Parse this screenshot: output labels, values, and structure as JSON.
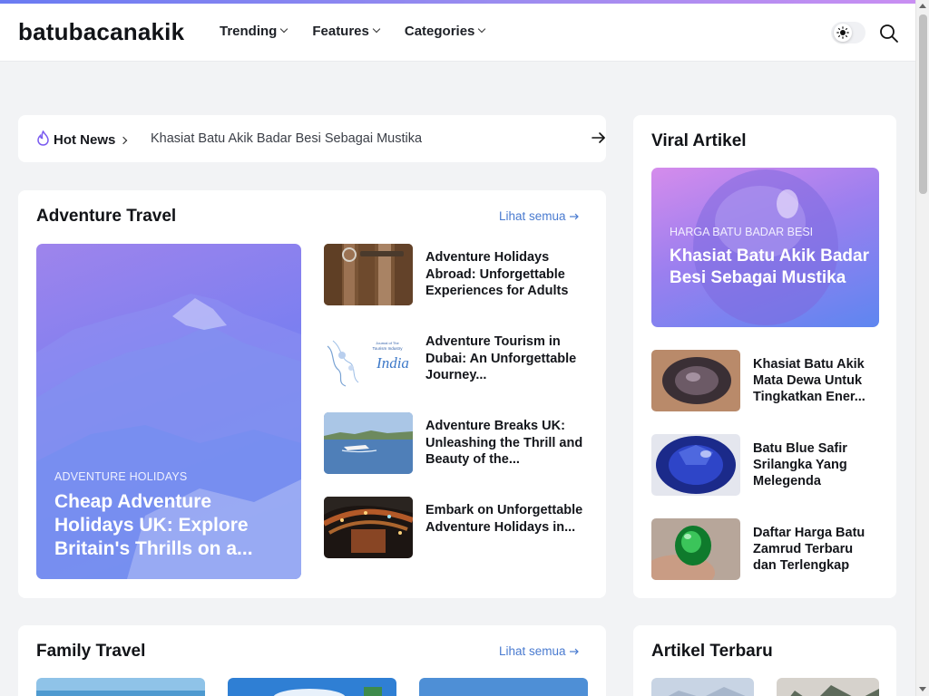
{
  "site": {
    "logo": "batubacanakik",
    "nav": [
      {
        "label": "Trending"
      },
      {
        "label": "Features"
      },
      {
        "label": "Categories"
      }
    ],
    "accent": "#4a7bd0",
    "stripe_colors": [
      "#6a7bf2",
      "#c98ef2"
    ]
  },
  "hot_news": {
    "label": "Hot News",
    "title": "Khasiat Batu Akik Badar Besi Sebagai Mustika",
    "icons": [
      "fire-icon",
      "arrow-right-icon"
    ]
  },
  "adventure": {
    "heading": "Adventure Travel",
    "see_all": "Lihat semua",
    "feature": {
      "category": "ADVENTURE HOLIDAYS",
      "title": "Cheap Adventure Holidays UK: Explore Britain's Thrills on a..."
    },
    "posts": [
      {
        "title": "Adventure Holidays Abroad: Unforgettable Experiences for Adults"
      },
      {
        "title": "Adventure Tourism in Dubai: An Unforgettable Journey..."
      },
      {
        "title": "Adventure Breaks UK: Unleashing the Thrill and Beauty of the..."
      },
      {
        "title": "Embark on Unforgettable Adventure Holidays in..."
      }
    ],
    "thumb_text": {
      "line1": "Journal of The",
      "line2": "Tourism Industry",
      "word": "India"
    }
  },
  "family": {
    "heading": "Family Travel",
    "see_all": "Lihat semua"
  },
  "viral": {
    "heading": "Viral Artikel",
    "feature": {
      "category": "HARGA BATU BADAR BESI",
      "title": "Khasiat Batu Akik Badar Besi Sebagai Mustika"
    },
    "posts": [
      {
        "title": "Khasiat Batu Akik Mata Dewa Untuk Tingkatkan Ener..."
      },
      {
        "title": "Batu Blue Safir Srilangka Yang Melegenda"
      },
      {
        "title": "Daftar Harga Batu Zamrud Terbaru dan Terlengkap"
      }
    ]
  },
  "latest": {
    "heading": "Artikel Terbaru"
  }
}
